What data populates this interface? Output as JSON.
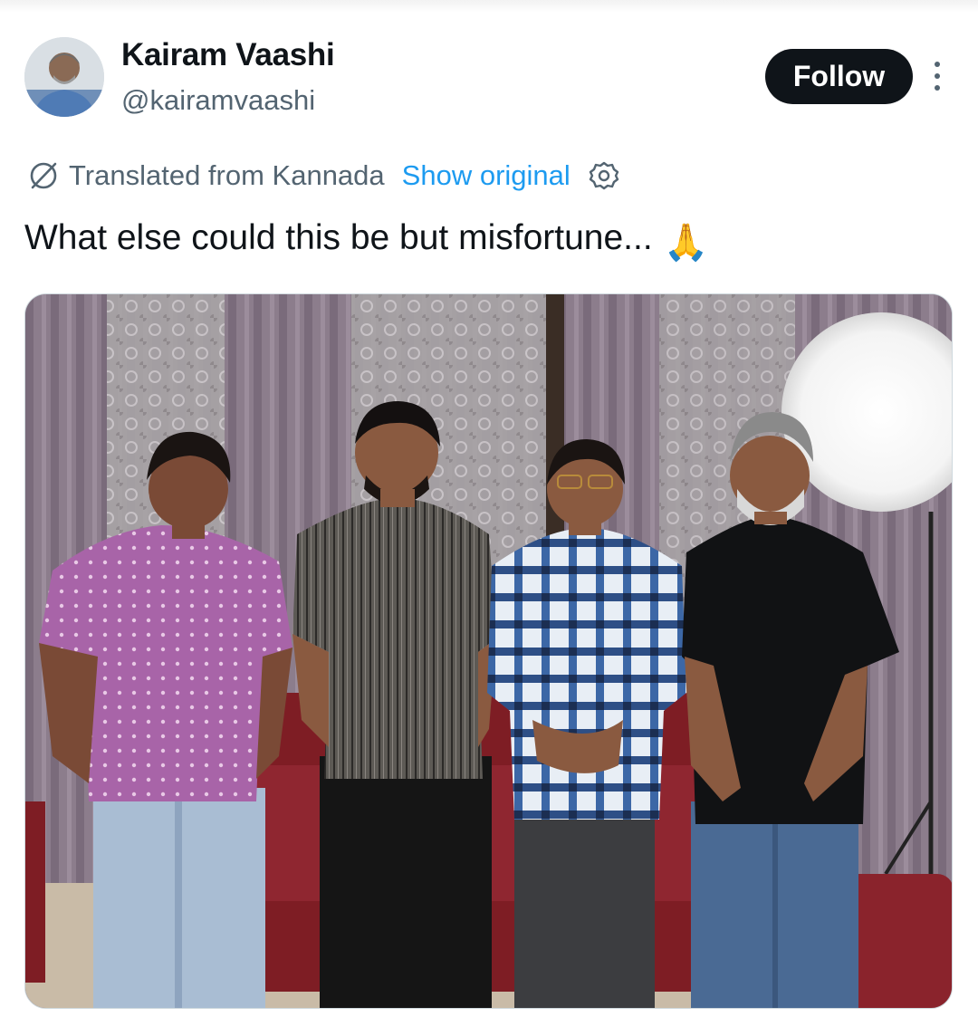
{
  "author": {
    "display_name": "Kairam Vaashi",
    "handle": "@kairamvaashi",
    "avatar_icon": "profile-photo"
  },
  "actions": {
    "follow_label": "Follow",
    "more_icon": "more-vertical-icon"
  },
  "translation": {
    "icon": "translate-icon",
    "label": "Translated from Kannada",
    "show_original_label": "Show original",
    "settings_icon": "gear-icon"
  },
  "tweet": {
    "text": "What else could this be but misfortune...",
    "emoji": "🙏"
  },
  "media": {
    "type": "photo",
    "description_icon": "group-photo-image"
  },
  "colors": {
    "text_primary": "#0f1419",
    "text_secondary": "#536471",
    "link": "#1d9bf0",
    "button_bg": "#0f1419",
    "button_text": "#ffffff"
  }
}
